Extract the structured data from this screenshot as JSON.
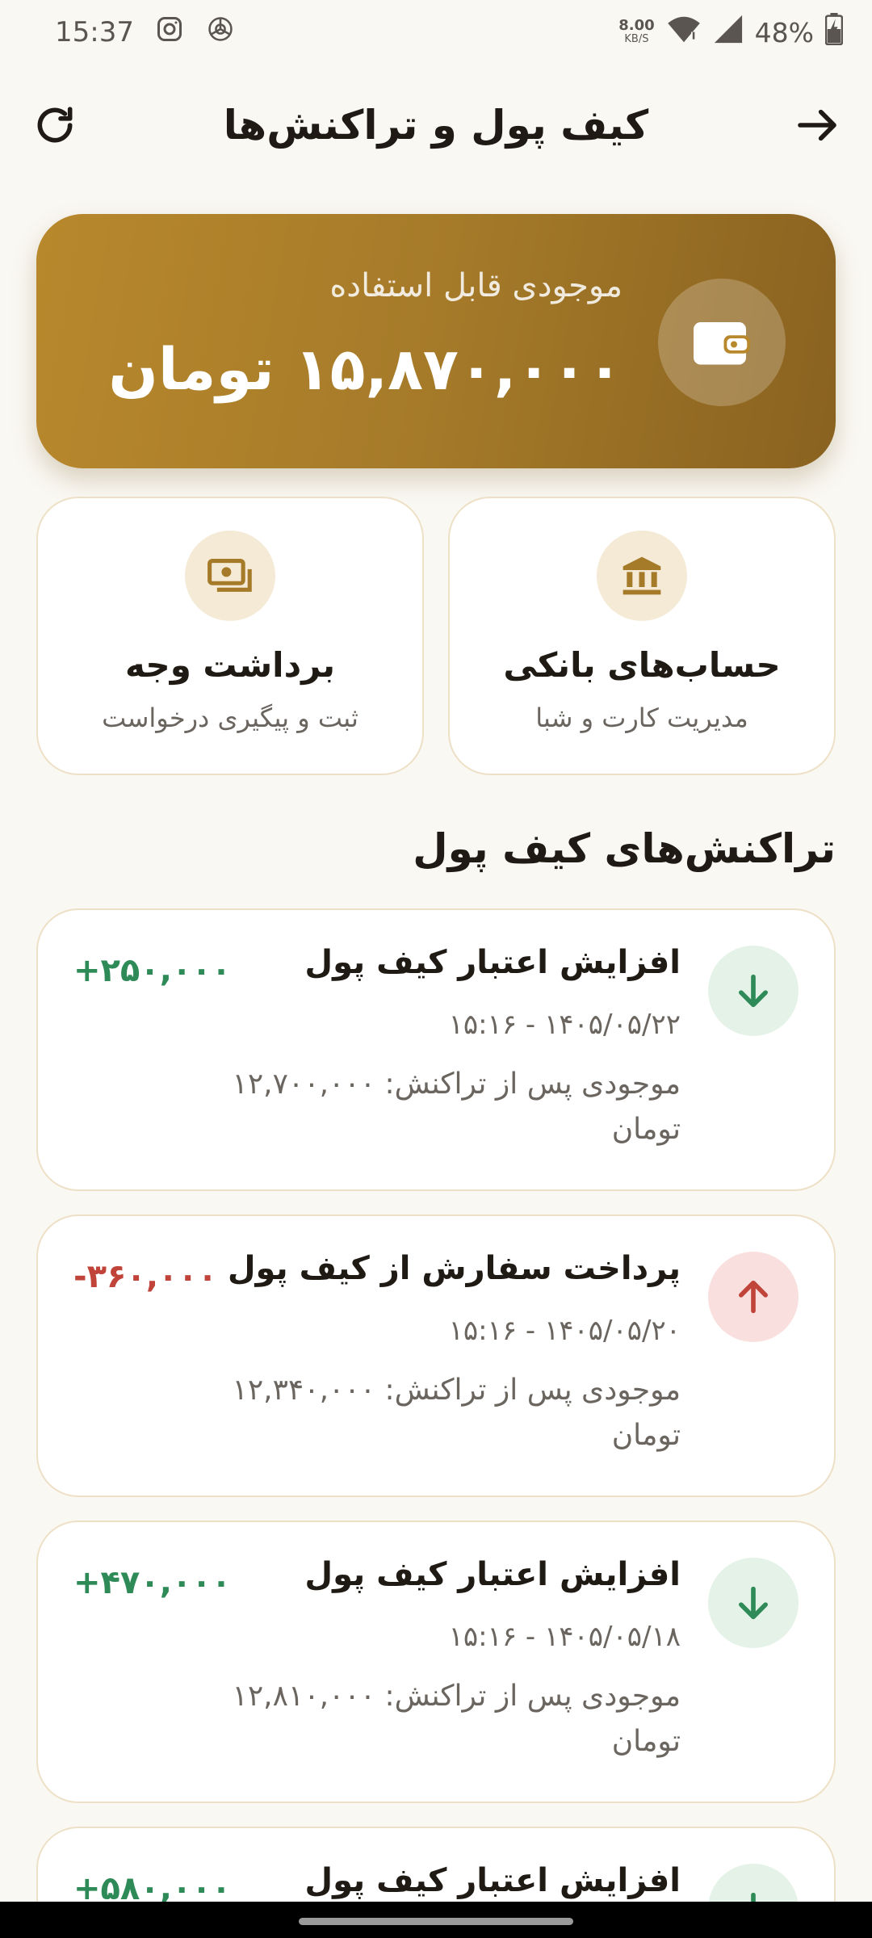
{
  "status_bar": {
    "time": "15:37",
    "net_speed_value": "8.00",
    "net_speed_unit": "KB/S",
    "battery": "48%",
    "icons": [
      "instagram-icon",
      "chatgpt-icon",
      "wifi-icon",
      "signal-icon",
      "battery-charging-icon"
    ]
  },
  "appbar": {
    "title": "کیف پول و تراکنش‌ها",
    "back_icon": "arrow-right-icon",
    "refresh_icon": "refresh-icon"
  },
  "balance": {
    "label": "موجودی قابل استفاده",
    "amount": "۱۵,۸۷۰,۰۰۰ تومان",
    "icon": "wallet-icon"
  },
  "actions": [
    {
      "title": "حساب‌های بانکی",
      "subtitle": "مدیریت کارت و شبا",
      "icon": "bank-icon"
    },
    {
      "title": "برداشت وجه",
      "subtitle": "ثبت و پیگیری درخواست",
      "icon": "cash-icon"
    }
  ],
  "transactions_section": {
    "title": "تراکنش‌های کیف پول"
  },
  "transactions": [
    {
      "title": "افزایش اعتبار کیف پول",
      "date": "۱۴۰۵/۰۵/۲۲ - ۱۵:۱۶",
      "balance_after": "موجودی پس از تراکنش: ۱۲,۷۰۰,۰۰۰ تومان",
      "amount": "+۲۵۰,۰۰۰",
      "direction": "in"
    },
    {
      "title": "پرداخت سفارش از کیف پول",
      "date": "۱۴۰۵/۰۵/۲۰ - ۱۵:۱۶",
      "balance_after": "موجودی پس از تراکنش: ۱۲,۳۴۰,۰۰۰ تومان",
      "amount": "-۳۶۰,۰۰۰",
      "direction": "out"
    },
    {
      "title": "افزایش اعتبار کیف پول",
      "date": "۱۴۰۵/۰۵/۱۸ - ۱۵:۱۶",
      "balance_after": "موجودی پس از تراکنش: ۱۲,۸۱۰,۰۰۰ تومان",
      "amount": "+۴۷۰,۰۰۰",
      "direction": "in"
    },
    {
      "title": "افزایش اعتبار کیف پول",
      "amount": "+۵۸۰,۰۰۰",
      "direction": "in"
    }
  ],
  "colors": {
    "background": "#faf8f3",
    "accent_gold": "#a57a29",
    "income_green": "#2e8a57",
    "expense_red": "#c0443a"
  }
}
